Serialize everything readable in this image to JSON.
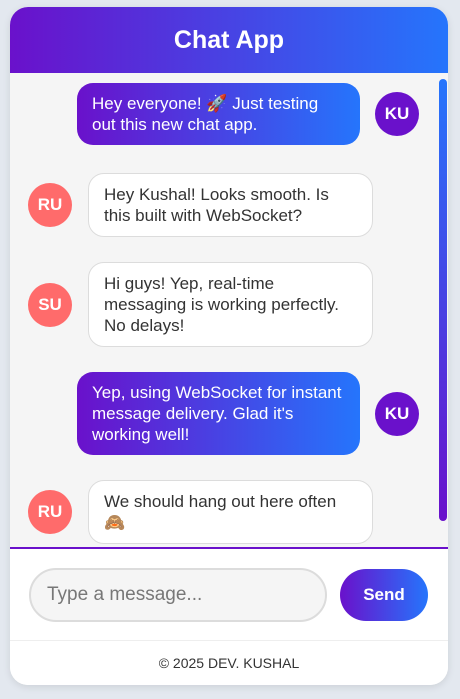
{
  "app": {
    "title": "Chat App"
  },
  "messages": [
    {
      "sender": "self",
      "initials": "KU",
      "text": "Hey everyone! 🚀 Just testing out this new chat app."
    },
    {
      "sender": "other",
      "initials": "RU",
      "text": "Hey Kushal! Looks smooth. Is this built with WebSocket?"
    },
    {
      "sender": "other",
      "initials": "SU",
      "text": "Hi guys! Yep, real-time messaging is working perfectly. No delays!"
    },
    {
      "sender": "self",
      "initials": "KU",
      "text": "Yep, using WebSocket for instant message delivery. Glad it's working well!"
    },
    {
      "sender": "other",
      "initials": "RU",
      "text": "We should hang out here often 🙈"
    }
  ],
  "composer": {
    "placeholder": "Type a message...",
    "value": "",
    "send_label": "Send"
  },
  "footer": {
    "text": "© 2025 DEV. KUSHAL"
  },
  "colors": {
    "gradient_start": "#6a11cb",
    "gradient_end": "#2575fc",
    "other_avatar": "#ff6b6b"
  }
}
